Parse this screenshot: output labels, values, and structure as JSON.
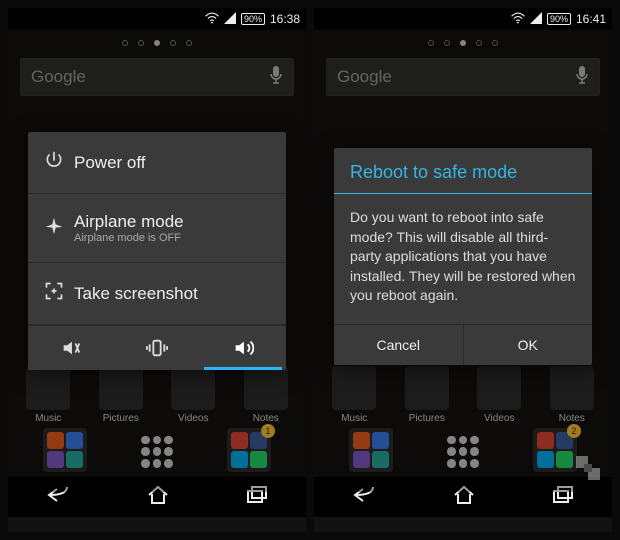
{
  "left": {
    "status": {
      "battery": "90%",
      "time": "16:38"
    },
    "search": {
      "placeholder": "Google"
    },
    "menu": {
      "power_off": "Power off",
      "airplane_label": "Airplane mode",
      "airplane_sub": "Airplane mode is OFF",
      "screenshot": "Take screenshot"
    },
    "apps_row1": {
      "music": "Music",
      "pictures": "Pictures",
      "videos": "Videos",
      "notes": "Notes"
    },
    "folder_badge": "1"
  },
  "right": {
    "status": {
      "battery": "90%",
      "time": "16:41"
    },
    "search": {
      "placeholder": "Google"
    },
    "dialog": {
      "title": "Reboot to safe mode",
      "body": "Do you want to reboot into safe mode? This will disable all third-party applications that you have installed. They will be restored when you reboot again.",
      "cancel": "Cancel",
      "ok": "OK"
    },
    "apps_row1": {
      "music": "Music",
      "pictures": "Pictures",
      "videos": "Videos",
      "notes": "Notes"
    },
    "folder_badge": "2"
  }
}
